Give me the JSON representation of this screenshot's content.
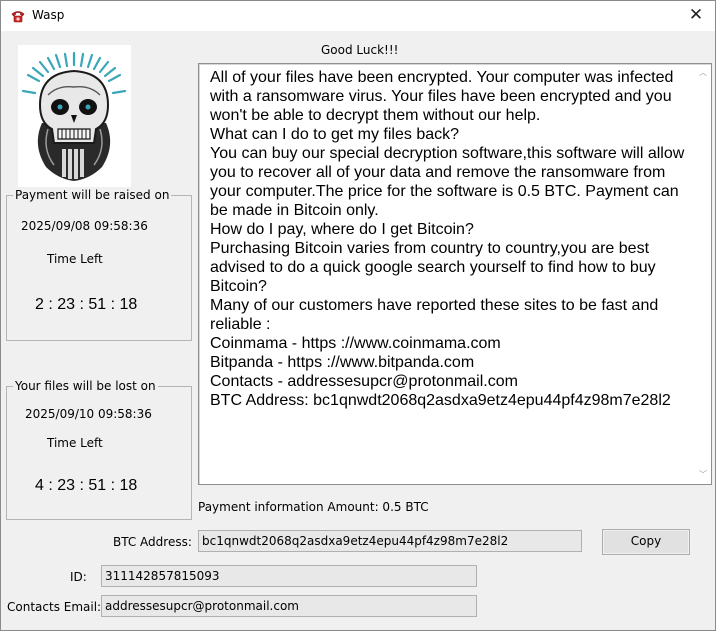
{
  "window": {
    "title": "Wasp",
    "close_glyph": "✕",
    "icon": "red-telephone-icon"
  },
  "header": {
    "good_luck": "Good Luck!!!"
  },
  "raise_group": {
    "title": "Payment will be raised on",
    "datetime": "2025/09/08 09:58:36",
    "time_left_label": "Time Left",
    "countdown": "2 : 23 : 51 : 18"
  },
  "lost_group": {
    "title": "Your files will be lost on",
    "datetime": "2025/09/10 09:58:36",
    "time_left_label": "Time Left",
    "countdown": "4 : 23 : 51 : 18"
  },
  "message": {
    "lines": [
      "All of your files have been encrypted. Your computer was infected with a ransomware virus. Your files have been encrypted and you won't be able to decrypt them without our help.",
      "What can I do to get my files back?",
      "You can buy our special decryption software,this software will allow you to recover all of your data and remove the ransomware from your computer.The price for the software is 0.5 BTC. Payment can be made in Bitcoin only.",
      "How do I pay, where do I get Bitcoin?",
      "Purchasing Bitcoin varies from country to country,you are best advised to do a quick google search yourself to find how to buy Bitcoin?",
      "Many of our customers have reported these sites to be fast and reliable :",
      "Coinmama - https ://www.coinmama.com",
      "Bitpanda - https ://www.bitpanda.com",
      "Contacts - addressesupcr@protonmail.com",
      "BTC Address: bc1qnwdt2068q2asdxa9etz4epu44pf4z98m7e28l2"
    ]
  },
  "payment_info": "Payment information Amount: 0.5 BTC",
  "form": {
    "btc_label": "BTC Address:",
    "btc_value": "bc1qnwdt2068q2asdxa9etz4epu44pf4z98m7e28l2",
    "copy_label": "Copy",
    "id_label": "ID:",
    "id_value": "311142857815093",
    "email_label": "Contacts Email:",
    "email_value": "addressesupcr@protonmail.com"
  }
}
